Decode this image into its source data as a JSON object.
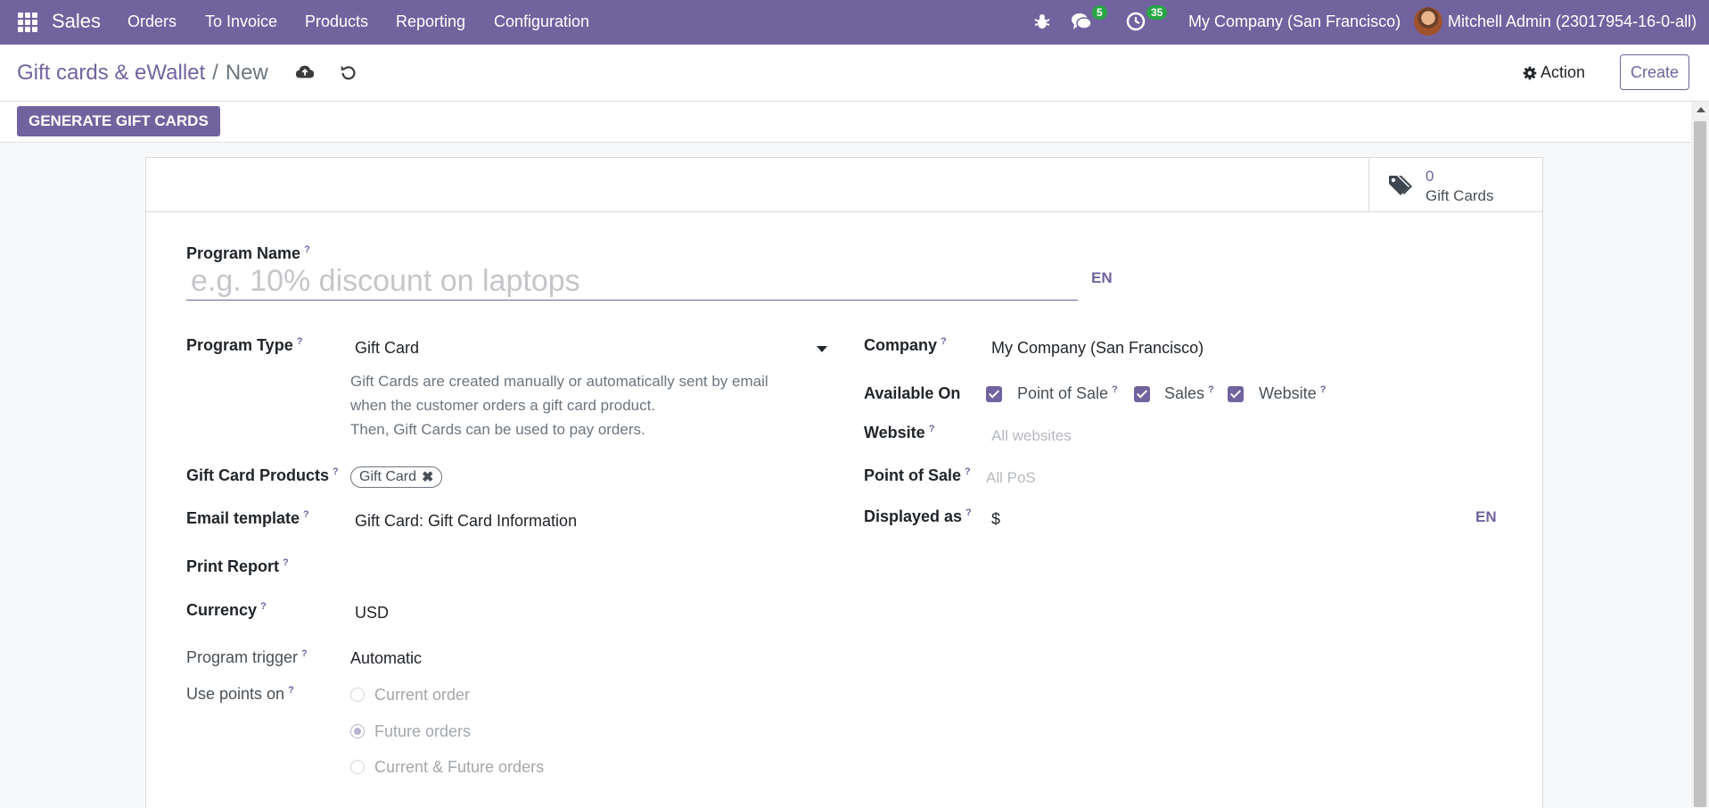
{
  "navbar": {
    "app_name": "Sales",
    "menu": [
      "Orders",
      "To Invoice",
      "Products",
      "Reporting",
      "Configuration"
    ],
    "messages_count": "5",
    "activities_count": "35",
    "company": "My Company (San Francisco)",
    "user": "Mitchell Admin (23017954-16-0-all)"
  },
  "breadcrumb": {
    "parent": "Gift cards & eWallet",
    "separator": "/",
    "current": "New"
  },
  "toolbar": {
    "action_label": "Action",
    "create_label": "Create",
    "generate_label": "GENERATE GIFT CARDS"
  },
  "stat_button": {
    "value": "0",
    "label": "Gift Cards"
  },
  "form": {
    "program_name": {
      "label": "Program Name",
      "placeholder": "e.g. 10% discount on laptops",
      "lang": "EN"
    },
    "program_type": {
      "label": "Program Type",
      "value": "Gift Card",
      "description": [
        "Gift Cards are created manually or automatically sent by email",
        "when the customer orders a gift card product.",
        "Then, Gift Cards can be used to pay orders."
      ]
    },
    "gift_card_products": {
      "label": "Gift Card Products",
      "tags": [
        "Gift Card"
      ]
    },
    "email_template": {
      "label": "Email template",
      "value": "Gift Card: Gift Card Information"
    },
    "print_report": {
      "label": "Print Report",
      "value": ""
    },
    "currency": {
      "label": "Currency",
      "value": "USD"
    },
    "program_trigger": {
      "label": "Program trigger",
      "value": "Automatic"
    },
    "use_points_on": {
      "label": "Use points on",
      "options": [
        "Current order",
        "Future orders",
        "Current & Future orders"
      ],
      "selected": "Future orders"
    },
    "company": {
      "label": "Company",
      "value": "My Company (San Francisco)"
    },
    "available_on": {
      "label": "Available On",
      "options": [
        "Point of Sale",
        "Sales",
        "Website"
      ],
      "checked": [
        true,
        true,
        true
      ]
    },
    "website": {
      "label": "Website",
      "placeholder": "All websites"
    },
    "point_of_sale": {
      "label": "Point of Sale",
      "placeholder": "All PoS"
    },
    "displayed_as": {
      "label": "Displayed as",
      "value": "$",
      "lang": "EN"
    },
    "help_mark": "?"
  },
  "colors": {
    "brand": "#71639e",
    "badge": "#28a745"
  }
}
